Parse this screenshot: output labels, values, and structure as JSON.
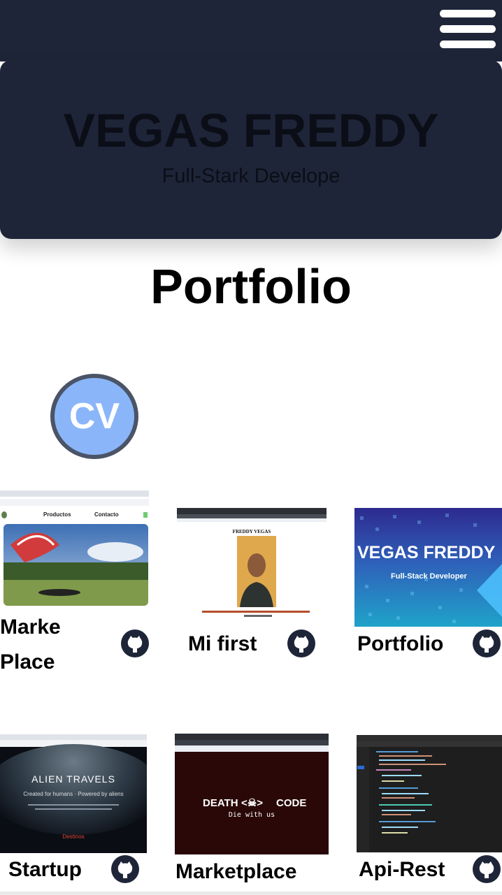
{
  "header": {
    "menu_icon": "hamburger-icon"
  },
  "hero": {
    "name": "VEGAS FREDDY",
    "subtitle": "Full-Stark Develope"
  },
  "section": {
    "title": "Portfolio"
  },
  "cv": {
    "label": "CV"
  },
  "projects": [
    {
      "title_line1": "Marke",
      "title_line2": "Place",
      "thumb": {
        "nav_left": "Productos",
        "nav_right": "Contacto"
      },
      "repo_icon": "github-icon"
    },
    {
      "title": "Mi first",
      "thumb": {
        "heading": "FREDDY VEGAS"
      },
      "repo_icon": "github-icon"
    },
    {
      "title": "Portfolio",
      "thumb": {
        "heading": "VEGAS FREDDY",
        "subtitle": "Full-Stack Developer"
      },
      "repo_icon": "github-icon"
    },
    {
      "title": "Startup",
      "thumb": {
        "heading": "ALIEN TRAVELS",
        "subtitle": "Created for humans · Powered by aliens",
        "button": "Destinos"
      },
      "repo_icon": "github-icon"
    },
    {
      "title": "Marketplace",
      "thumb": {
        "heading_left": "DEATH",
        "heading_right": "CODE",
        "subtitle": "Die with us"
      },
      "repo_icon": "github-icon"
    },
    {
      "title": "Api-Rest",
      "thumb": {},
      "repo_icon": "github-icon"
    }
  ],
  "colors": {
    "navy": "#1e2538",
    "cv_blue": "#8ab6f9",
    "cv_border": "#4b5467"
  }
}
